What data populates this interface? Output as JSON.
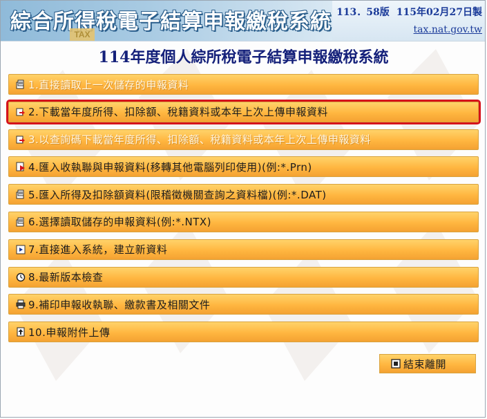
{
  "header": {
    "app_title": "綜合所得稅電子結算申報繳稅系統",
    "badge": "TAX",
    "version": "113．58版",
    "build_date": "115年02月27日製",
    "site": "tax.nat.gov.tw"
  },
  "main_title": "114年度個人綜所稅電子結算申報繳稅系統",
  "menu": {
    "items": [
      {
        "label": "1.直接讀取上一次儲存的申報資料",
        "icon": "document-edit-icon",
        "state": "disabled"
      },
      {
        "label": "2.下載當年度所得、扣除額、稅籍資料或本年上次上傳申報資料",
        "icon": "download-icon",
        "state": "selected"
      },
      {
        "label": "3.以查詢碼下載當年度所得、扣除額、稅籍資料或本年上次上傳申報資料",
        "icon": "download-icon",
        "state": "disabled"
      },
      {
        "label": "4.匯入收執聯與申報資料(移轉其他電腦列印使用)(例:*.Prn)",
        "icon": "import-icon",
        "state": "normal"
      },
      {
        "label": "5.匯入所得及扣除額資料(限稽徵機關查詢之資料檔)(例:*.DAT)",
        "icon": "document-edit-icon",
        "state": "normal"
      },
      {
        "label": "6.選擇讀取儲存的申報資料(例:*.NTX)",
        "icon": "document-edit-icon",
        "state": "normal"
      },
      {
        "label": "7.直接進入系統，建立新資料",
        "icon": "enter-icon",
        "state": "normal"
      },
      {
        "label": "8.最新版本檢查",
        "icon": "clock-icon",
        "state": "normal"
      },
      {
        "label": "9.補印申報收執聯、繳款書及相關文件",
        "icon": "printer-icon",
        "state": "normal"
      },
      {
        "label": "10.申報附件上傳",
        "icon": "upload-icon",
        "state": "normal"
      }
    ]
  },
  "exit": {
    "label": "結束離開",
    "icon": "exit-icon"
  },
  "colors": {
    "button_top": "#ffd36a",
    "button_bottom": "#f4a232",
    "selected_border": "#d6121b",
    "title": "#14207a",
    "link": "#1a3a99"
  }
}
